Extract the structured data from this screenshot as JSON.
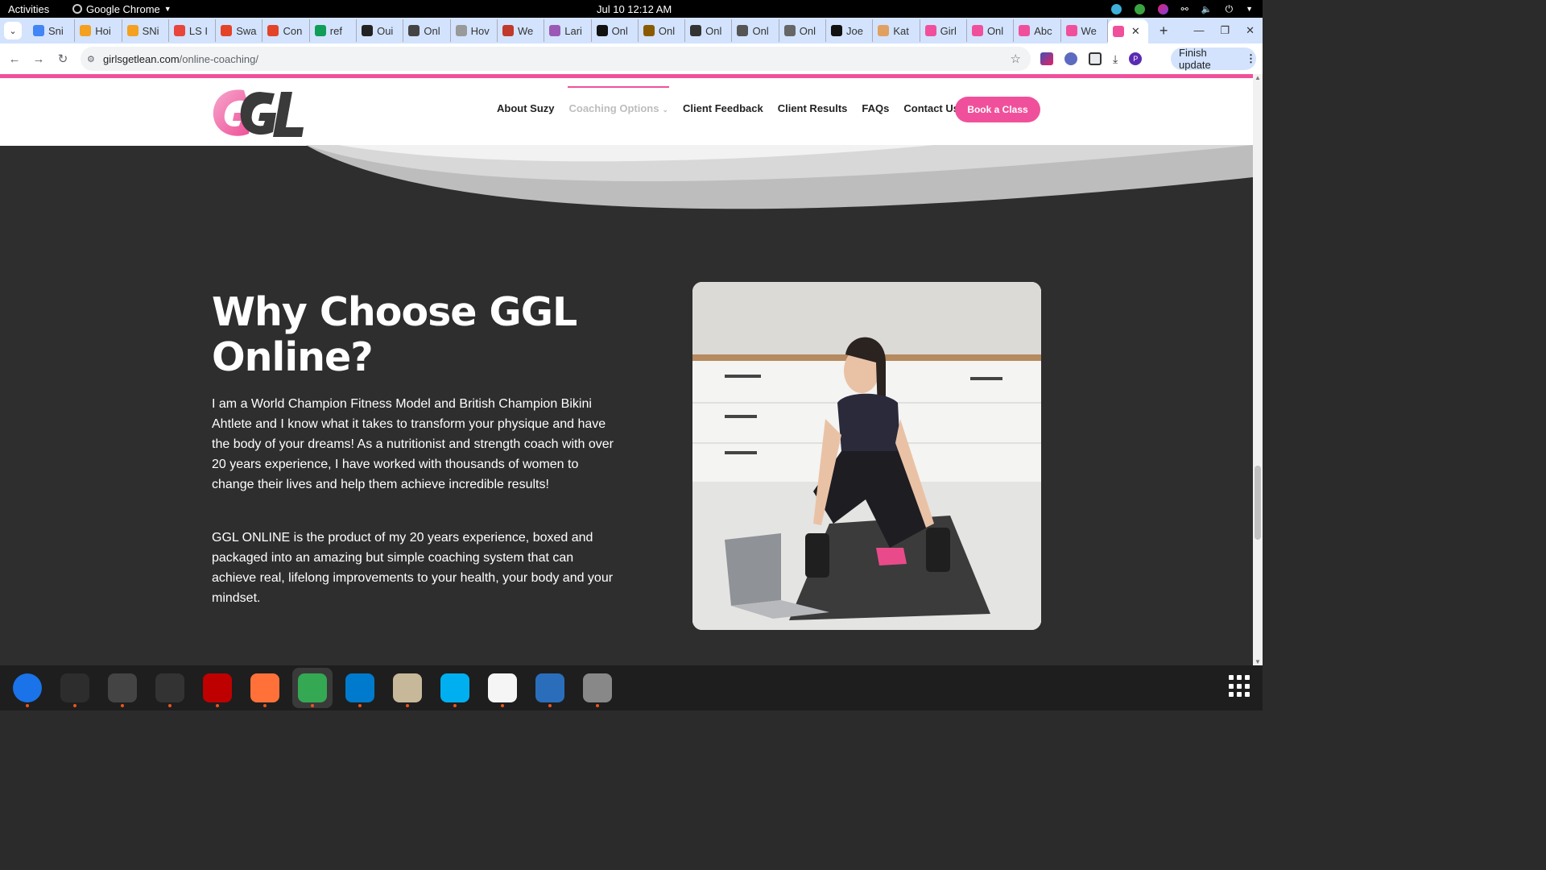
{
  "system_bar": {
    "activities": "Activities",
    "app_name": "Google Chrome",
    "clock": "Jul 10  12:12 AM"
  },
  "tabs": [
    {
      "label": "Sni",
      "color": "#4285f4"
    },
    {
      "label": "Hoi",
      "color": "#f4a020"
    },
    {
      "label": "SNi",
      "color": "#f4a020"
    },
    {
      "label": "LS I",
      "color": "#e8453c"
    },
    {
      "label": "Swa",
      "color": "#e24329"
    },
    {
      "label": "Con",
      "color": "#e24329"
    },
    {
      "label": "ref",
      "color": "#0f9d58"
    },
    {
      "label": "Oui",
      "color": "#222222"
    },
    {
      "label": "Onl",
      "color": "#444444"
    },
    {
      "label": "Hov",
      "color": "#999999"
    },
    {
      "label": "We",
      "color": "#c0392b"
    },
    {
      "label": "Lari",
      "color": "#9b59b6"
    },
    {
      "label": "Onl",
      "color": "#111111"
    },
    {
      "label": "Onl",
      "color": "#8a5a00"
    },
    {
      "label": "Onl",
      "color": "#333333"
    },
    {
      "label": "Onl",
      "color": "#555555"
    },
    {
      "label": "Onl",
      "color": "#666666"
    },
    {
      "label": "Joe",
      "color": "#111111"
    },
    {
      "label": "Kat",
      "color": "#e0a060"
    },
    {
      "label": "Girl",
      "color": "#f0509b"
    },
    {
      "label": "Onl",
      "color": "#f0509b"
    },
    {
      "label": "Abc",
      "color": "#f0509b"
    },
    {
      "label": "We",
      "color": "#f0509b"
    }
  ],
  "active_tab": {
    "color": "#f0509b"
  },
  "toolbar": {
    "url_domain": "girlsgetlean.com",
    "url_path": "/online-coaching/",
    "finish_update": "Finish update"
  },
  "site": {
    "brand_color": "#f0509b",
    "nav": {
      "about": "About Suzy",
      "coaching": "Coaching Options",
      "feedback": "Client Feedback",
      "results": "Client Results",
      "faqs": "FAQs",
      "contact": "Contact Us",
      "book": "Book a Class"
    },
    "hero": {
      "headline_line1": "Why Choose GGL",
      "headline_line2": "Online?",
      "paragraph1": "I am a World Champion Fitness Model and British Champion Bikini Ahtlete and I know what it takes to transform your physique and have the body of your dreams! As a nutritionist and strength coach with over 20 years experience, I have worked with thousands of women to change their lives and help them achieve incredible results!",
      "paragraph2": "GGL ONLINE is the product of my 20 years experience, boxed and packaged into an amazing but simple coaching system that can achieve real, lifelong improvements to your health, your body and your mindset."
    }
  },
  "dock": [
    {
      "name": "thunderbird",
      "color": "#1a73e8",
      "running": true
    },
    {
      "name": "terminal",
      "color": "#2d2d2d",
      "running": true
    },
    {
      "name": "calculator",
      "color": "#444444",
      "running": true
    },
    {
      "name": "system-monitor",
      "color": "#333333",
      "running": true
    },
    {
      "name": "filezilla",
      "color": "#bf0000",
      "running": true
    },
    {
      "name": "firefox",
      "color": "#ff7139",
      "running": true
    },
    {
      "name": "chrome",
      "color": "#34a853",
      "running": true
    },
    {
      "name": "vscode",
      "color": "#007acc",
      "running": true
    },
    {
      "name": "files",
      "color": "#c8b89a",
      "running": true
    },
    {
      "name": "skype",
      "color": "#00aff0",
      "running": true
    },
    {
      "name": "text-editor",
      "color": "#f5f5f5",
      "running": true
    },
    {
      "name": "document-viewer",
      "color": "#2a6ebb",
      "running": true
    },
    {
      "name": "disks",
      "color": "#888888",
      "running": true
    }
  ]
}
